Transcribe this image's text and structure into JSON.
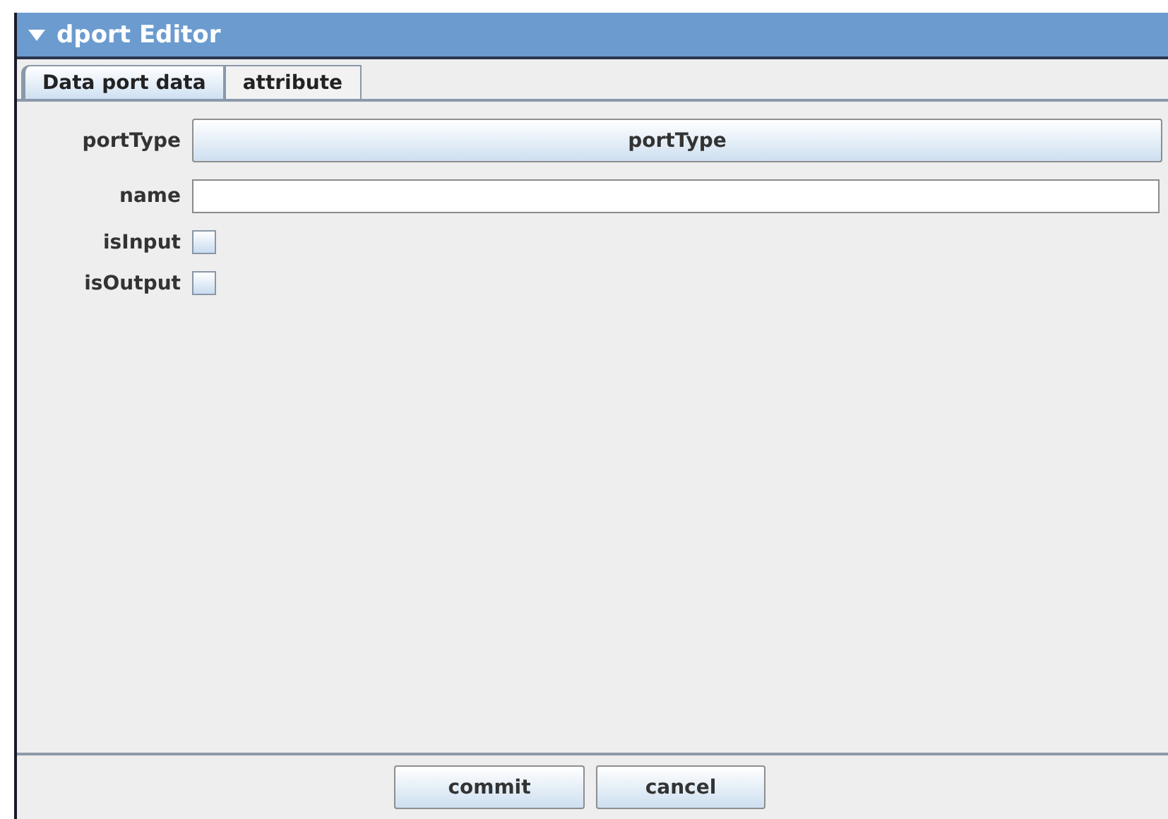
{
  "window": {
    "title": "dport Editor"
  },
  "tabs": [
    {
      "label": "Data port data",
      "selected": true
    },
    {
      "label": "attribute",
      "selected": false
    }
  ],
  "fields": [
    {
      "kind": "button",
      "label": "portType",
      "text": "portType"
    },
    {
      "kind": "text",
      "label": "name"
    },
    {
      "kind": "checkbox",
      "label": "isInput",
      "checked": false
    },
    {
      "kind": "checkbox",
      "label": "isOutput",
      "checked": false
    }
  ],
  "buttons": [
    "commit",
    "cancel"
  ]
}
